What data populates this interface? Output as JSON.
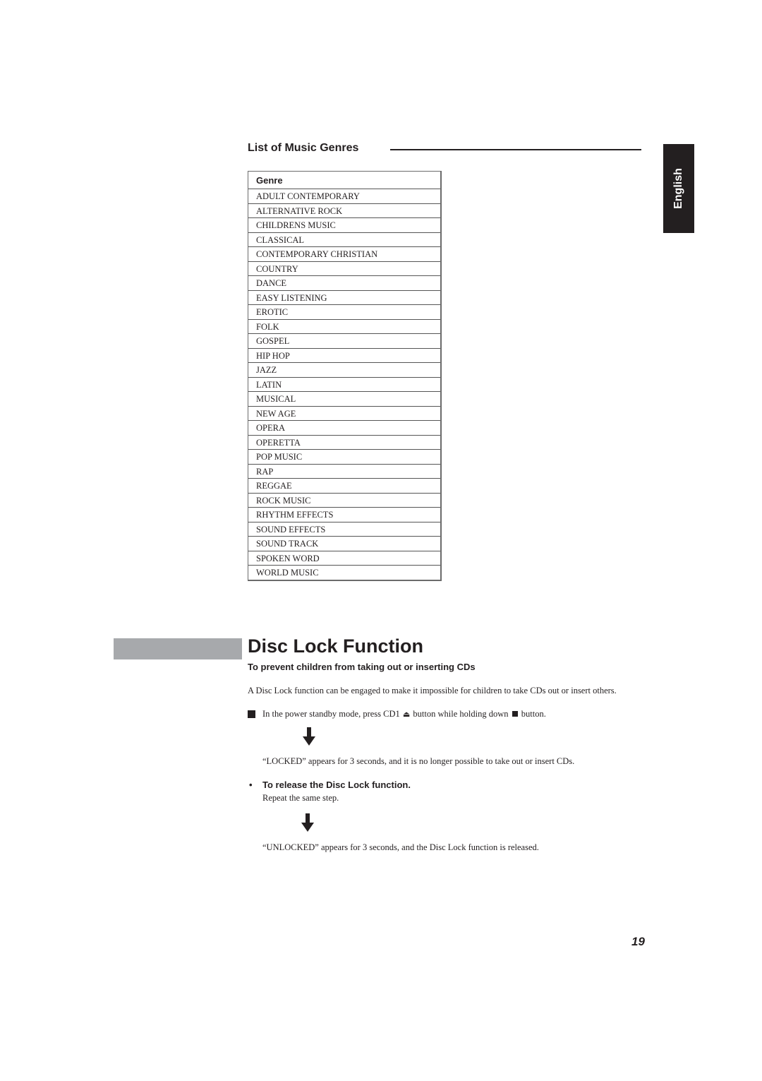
{
  "genres_section": {
    "title": "List of Music Genres",
    "table_header": "Genre",
    "genres": [
      "ADULT CONTEMPORARY",
      "ALTERNATIVE ROCK",
      "CHILDRENS MUSIC",
      "CLASSICAL",
      "CONTEMPORARY CHRISTIAN",
      "COUNTRY",
      "DANCE",
      "EASY LISTENING",
      "EROTIC",
      "FOLK",
      "GOSPEL",
      "HIP HOP",
      "JAZZ",
      "LATIN",
      "MUSICAL",
      "NEW AGE",
      "OPERA",
      "OPERETTA",
      "POP MUSIC",
      "RAP",
      "REGGAE",
      "ROCK MUSIC",
      "RHYTHM EFFECTS",
      "SOUND EFFECTS",
      "SOUND TRACK",
      "SPOKEN WORD",
      "WORLD MUSIC"
    ]
  },
  "language_tab": {
    "label": "English"
  },
  "disc_lock": {
    "title": "Disc Lock Function",
    "subtitle": "To prevent children from taking out or inserting CDs",
    "intro": "A Disc Lock function can be engaged to make it impossible for children to take CDs out or insert others.",
    "step": {
      "part1": "In the power standby mode, press CD1",
      "eject_icon": "eject-icon",
      "part2": "button while holding down",
      "stop_icon": "stop-icon",
      "part3": "button."
    },
    "locked_result": "“LOCKED” appears for 3 seconds, and it is no longer possible to take out or insert CDs.",
    "release": {
      "bullet": "•",
      "title": "To release the Disc Lock function.",
      "step": "Repeat the same step.",
      "result": "“UNLOCKED” appears for 3 seconds, and the Disc Lock function is released."
    }
  },
  "page_number": "19",
  "colors": {
    "text": "#231f20",
    "gray_bar": "#a7a9ac",
    "tab_bg": "#231f20"
  }
}
